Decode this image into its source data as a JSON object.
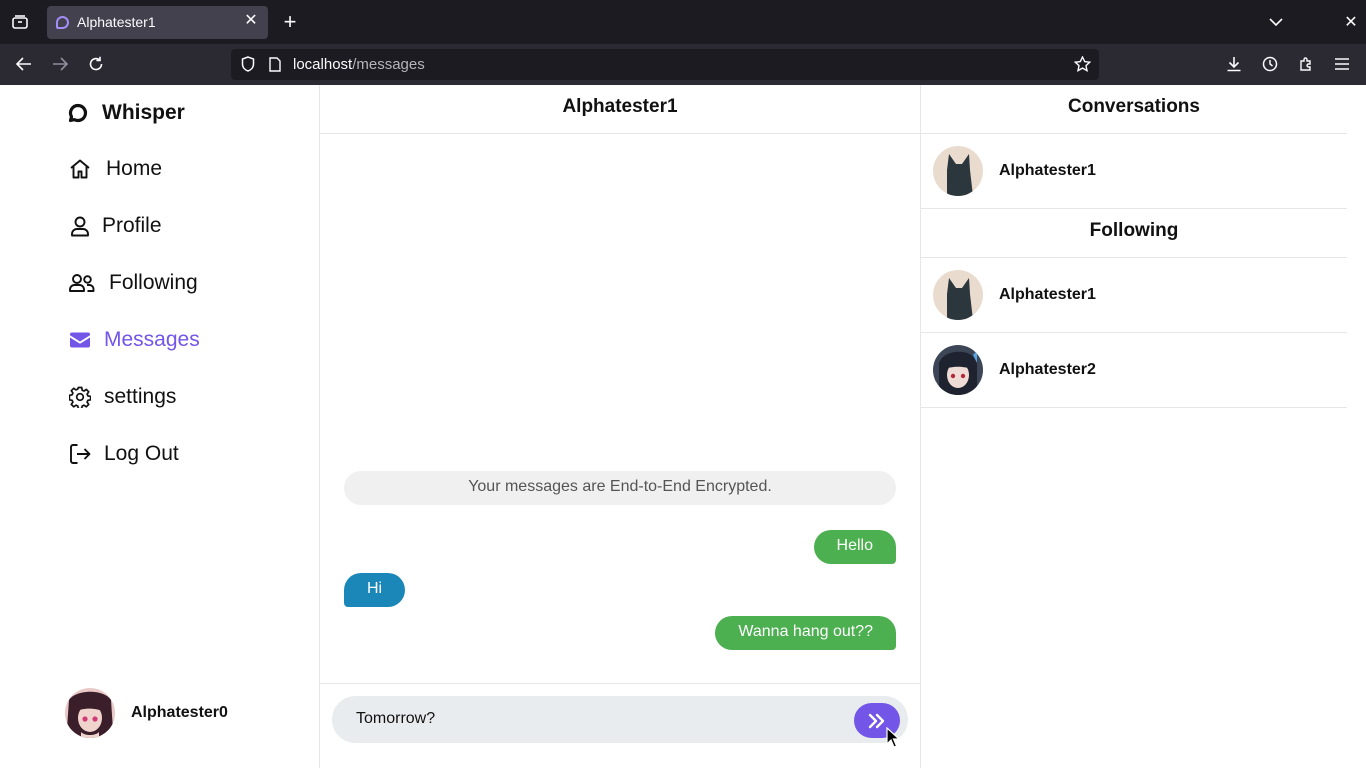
{
  "browser": {
    "tab_title": "Alphatester1",
    "url_host": "localhost",
    "url_path": "/messages"
  },
  "sidebar": {
    "brand": "Whisper",
    "items": [
      {
        "label": "Home",
        "icon": "home-icon"
      },
      {
        "label": "Profile",
        "icon": "user-icon"
      },
      {
        "label": "Following",
        "icon": "users-icon"
      },
      {
        "label": "Messages",
        "icon": "envelope-icon",
        "active": true
      },
      {
        "label": "settings",
        "icon": "gear-icon"
      },
      {
        "label": "Log Out",
        "icon": "logout-icon"
      }
    ],
    "current_user": "Alphatester0"
  },
  "chat": {
    "title": "Alphatester1",
    "notice": "Your messages are End-to-End Encrypted.",
    "messages": [
      {
        "text": "Hello",
        "direction": "outgoing"
      },
      {
        "text": "Hi",
        "direction": "incoming"
      },
      {
        "text": "Wanna hang out??",
        "direction": "outgoing"
      }
    ],
    "input_value": "Tomorrow?"
  },
  "panel": {
    "conversations_title": "Conversations",
    "conversations": [
      "Alphatester1"
    ],
    "following_title": "Following",
    "following": [
      "Alphatester1",
      "Alphatester2"
    ]
  },
  "colors": {
    "accent": "#7355e8",
    "outgoing_bubble": "#4caf50",
    "incoming_bubble": "#1a87b8"
  }
}
